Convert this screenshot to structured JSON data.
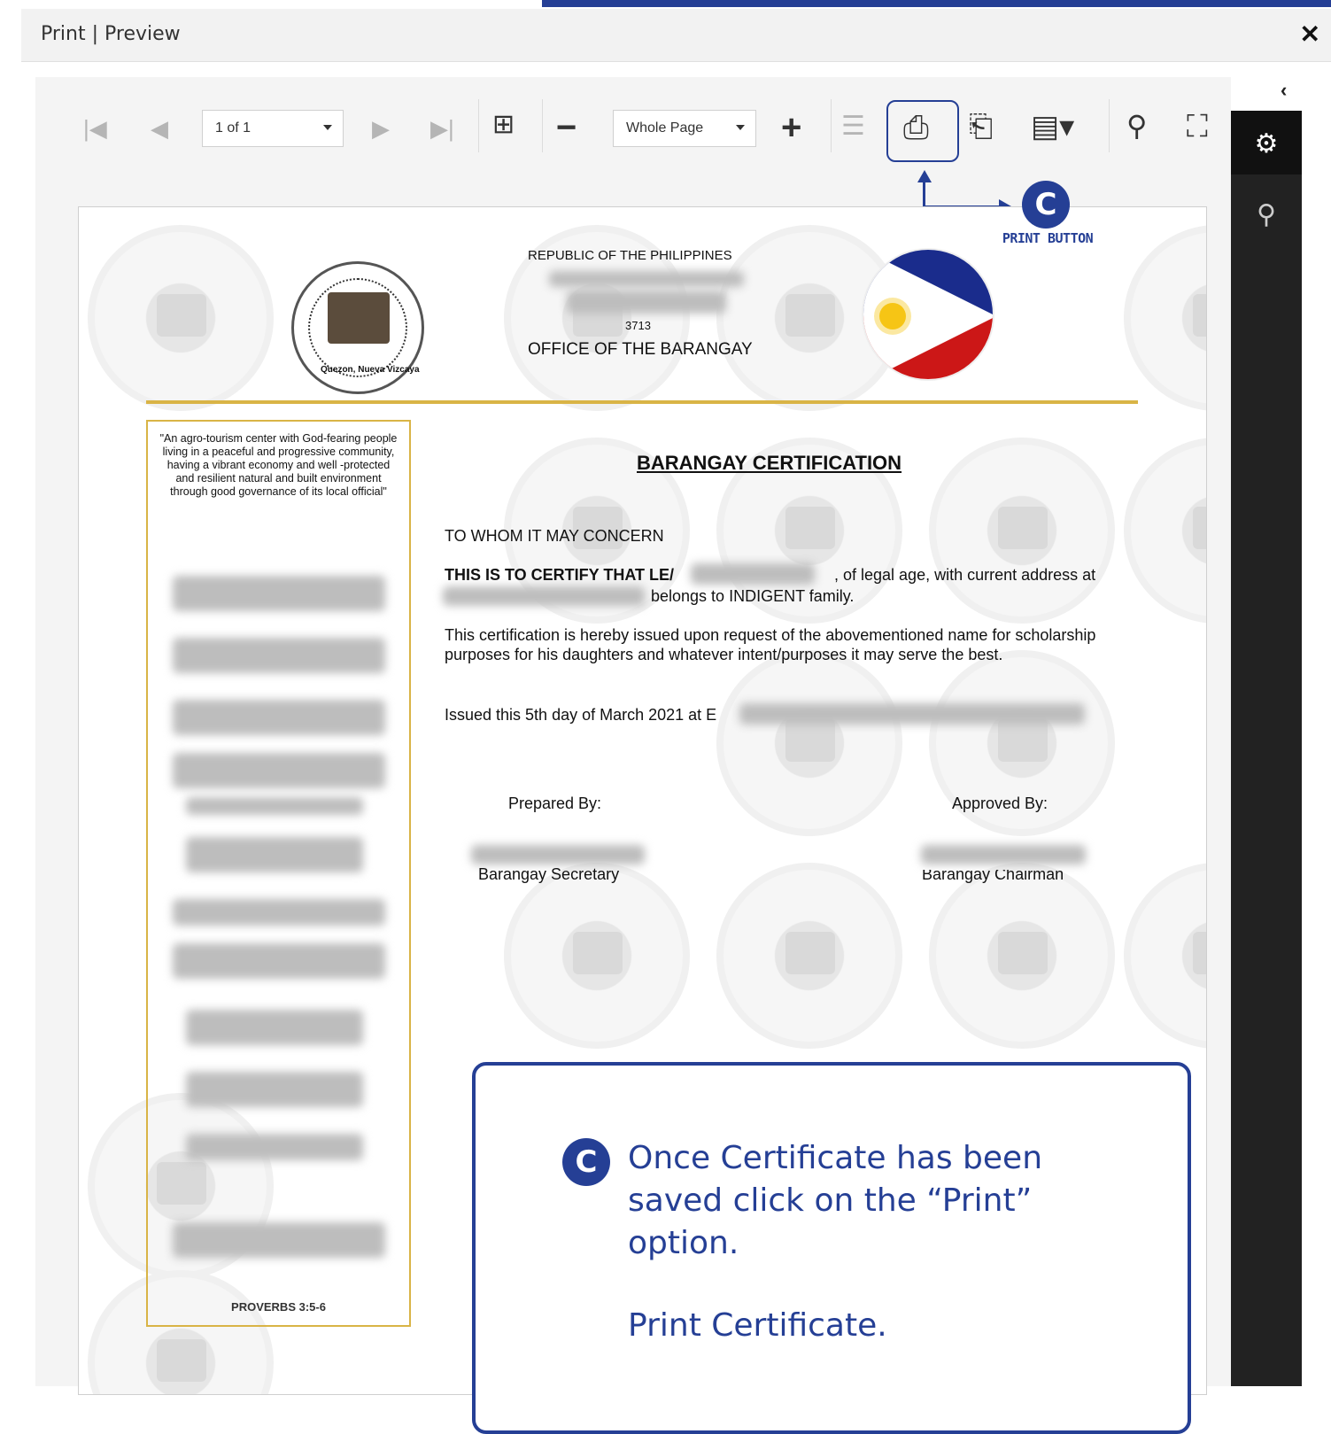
{
  "dialog": {
    "title": "Print | Preview",
    "close_icon": "close-icon"
  },
  "toolbar": {
    "page_selector": "1 of 1",
    "zoom_selector": "Whole Page",
    "icons": [
      "first-page-icon",
      "prev-page-icon",
      "next-page-icon",
      "last-page-icon",
      "multipage-icon",
      "zoom-out-icon",
      "zoom-in-icon",
      "editing-fields-icon",
      "print-icon",
      "print-page-icon",
      "export-icon",
      "search-icon",
      "fullscreen-icon"
    ]
  },
  "annotation": {
    "badge": "C",
    "label": "PRINT BUTTON"
  },
  "document": {
    "header_republic": "REPUBLIC OF THE PHILIPPINES",
    "header_zip": "3713",
    "header_office": "OFFICE OF THE BARANGAY",
    "motto": "\"An agro-tourism center with God-fearing people living in a peaceful and progressive community, having a vibrant economy and well -protected and resilient natural and built environment through good governance of its local official\"",
    "proverbs": "PROVERBS 3:5-6",
    "title": "BARANGAY CERTIFICATION",
    "salutation": "TO WHOM IT MAY CONCERN",
    "certify_prefix": "THIS IS TO CERTIFY THAT LE/",
    "certify_suffix": ", of legal age, with current address at",
    "certify_line2": "belongs to INDIGENT family.",
    "purpose": "This certification is hereby issued upon request of the abovementioned name for scholarship purposes for his daughters and whatever intent/purposes it may serve the best.",
    "issued": "Issued this 5th day of March 2021 at E",
    "prepared_by": "Prepared By:",
    "approved_by": "Approved By:",
    "secretary": "Barangay Secretary",
    "chairman": "Barangay Chairman",
    "seal_caption": "Quezon, Nueva Vizcaya"
  },
  "callout": {
    "badge": "C",
    "text": "Once Certificate has been saved click on the “Print” option.",
    "text2": "Print Certificate."
  },
  "colors": {
    "accent": "#253f95",
    "gold": "#d9b446"
  }
}
